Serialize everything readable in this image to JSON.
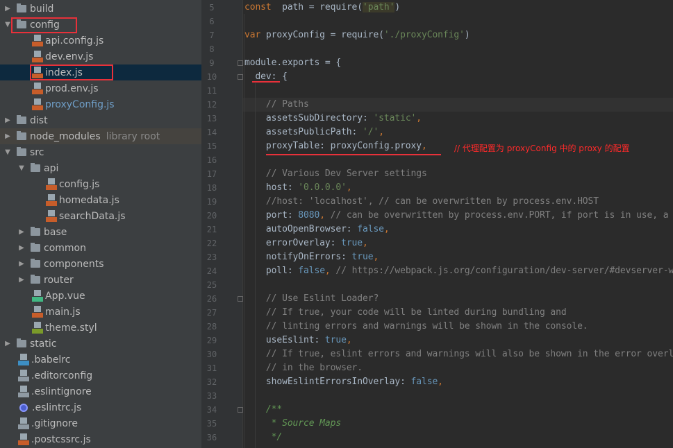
{
  "project_tree": {
    "items": [
      {
        "label": "build",
        "type": "folder",
        "expanded": false,
        "depth": 0
      },
      {
        "label": "config",
        "type": "folder",
        "expanded": true,
        "depth": 0,
        "highlighted": true
      },
      {
        "label": "api.config.js",
        "type": "js",
        "depth": 1
      },
      {
        "label": "dev.env.js",
        "type": "js",
        "depth": 1
      },
      {
        "label": "index.js",
        "type": "js",
        "depth": 1,
        "selected": true,
        "highlighted": true
      },
      {
        "label": "prod.env.js",
        "type": "js",
        "depth": 1
      },
      {
        "label": "proxyConfig.js",
        "type": "js",
        "depth": 1,
        "modified": true
      },
      {
        "label": "dist",
        "type": "folder",
        "expanded": false,
        "depth": 0
      },
      {
        "label": "node_modules",
        "type": "folder",
        "expanded": false,
        "depth": 0,
        "suffix": "library root"
      },
      {
        "label": "src",
        "type": "folder",
        "expanded": true,
        "depth": 0
      },
      {
        "label": "api",
        "type": "folder",
        "expanded": true,
        "depth": 1
      },
      {
        "label": "config.js",
        "type": "js",
        "depth": 2
      },
      {
        "label": "homedata.js",
        "type": "js",
        "depth": 2
      },
      {
        "label": "searchData.js",
        "type": "js",
        "depth": 2
      },
      {
        "label": "base",
        "type": "folder",
        "expanded": false,
        "depth": 1
      },
      {
        "label": "common",
        "type": "folder",
        "expanded": false,
        "depth": 1
      },
      {
        "label": "components",
        "type": "folder",
        "expanded": false,
        "depth": 1
      },
      {
        "label": "router",
        "type": "folder",
        "expanded": false,
        "depth": 1
      },
      {
        "label": "App.vue",
        "type": "vue",
        "depth": 1
      },
      {
        "label": "main.js",
        "type": "js",
        "depth": 1
      },
      {
        "label": "theme.styl",
        "type": "styl",
        "depth": 1
      },
      {
        "label": "static",
        "type": "folder",
        "expanded": false,
        "depth": 0
      },
      {
        "label": ".babelrc",
        "type": "json",
        "depth": 0
      },
      {
        "label": ".editorconfig",
        "type": "text",
        "depth": 0
      },
      {
        "label": ".eslintignore",
        "type": "text",
        "depth": 0
      },
      {
        "label": ".eslintrc.js",
        "type": "eslint",
        "depth": 0
      },
      {
        "label": ".gitignore",
        "type": "text",
        "depth": 0
      },
      {
        "label": ".postcssrc.js",
        "type": "js",
        "depth": 0
      }
    ]
  },
  "editor": {
    "annotation": "// 代理配置为 proxyConfig 中的 proxy 的配置",
    "lines": [
      {
        "n": "5",
        "seg": [
          [
            "kw",
            "const"
          ],
          [
            "",
            "  path = require("
          ],
          [
            "strhl",
            "'path'"
          ],
          [
            "",
            ")"
          ]
        ]
      },
      {
        "n": "6",
        "seg": []
      },
      {
        "n": "7",
        "seg": [
          [
            "kw",
            "var"
          ],
          [
            "",
            " proxyConfig = require("
          ],
          [
            "str",
            "'./proxyConfig'"
          ],
          [
            "",
            ")"
          ]
        ]
      },
      {
        "n": "8",
        "seg": []
      },
      {
        "n": "9",
        "seg": [
          [
            "",
            "module.exports = {"
          ]
        ]
      },
      {
        "n": "10",
        "seg": [
          [
            "",
            "  dev: {"
          ]
        ]
      },
      {
        "n": "11",
        "seg": []
      },
      {
        "n": "12",
        "seg": [
          [
            "",
            "    "
          ],
          [
            "cm",
            "// Paths"
          ]
        ]
      },
      {
        "n": "13",
        "seg": [
          [
            "",
            "    assetsSubDirectory: "
          ],
          [
            "str",
            "'static'"
          ],
          [
            "kw",
            ","
          ]
        ]
      },
      {
        "n": "14",
        "seg": [
          [
            "",
            "    assetsPublicPath: "
          ],
          [
            "str",
            "'/'"
          ],
          [
            "kw",
            ","
          ]
        ]
      },
      {
        "n": "15",
        "seg": [
          [
            "",
            "    proxyTable: proxyConfig.proxy"
          ],
          [
            "kw",
            ","
          ]
        ]
      },
      {
        "n": "16",
        "seg": []
      },
      {
        "n": "17",
        "seg": [
          [
            "",
            "    "
          ],
          [
            "cm",
            "// Various Dev Server settings"
          ]
        ]
      },
      {
        "n": "18",
        "seg": [
          [
            "",
            "    host: "
          ],
          [
            "str",
            "'0.0.0.0'"
          ],
          [
            "kw",
            ","
          ]
        ]
      },
      {
        "n": "19",
        "seg": [
          [
            "",
            "    "
          ],
          [
            "cm",
            "//host: 'localhost', // can be overwritten by process.env.HOST"
          ]
        ]
      },
      {
        "n": "20",
        "seg": [
          [
            "",
            "    port: "
          ],
          [
            "num",
            "8080"
          ],
          [
            "kw",
            ","
          ],
          [
            "cm",
            " // can be overwritten by process.env.PORT, if port is in use, a free one will be determined"
          ]
        ]
      },
      {
        "n": "21",
        "seg": [
          [
            "",
            "    autoOpenBrowser: "
          ],
          [
            "bool",
            "false"
          ],
          [
            "kw",
            ","
          ]
        ]
      },
      {
        "n": "22",
        "seg": [
          [
            "",
            "    errorOverlay: "
          ],
          [
            "bool",
            "true"
          ],
          [
            "kw",
            ","
          ]
        ]
      },
      {
        "n": "23",
        "seg": [
          [
            "",
            "    notifyOnErrors: "
          ],
          [
            "bool",
            "true"
          ],
          [
            "kw",
            ","
          ]
        ]
      },
      {
        "n": "24",
        "seg": [
          [
            "",
            "    poll: "
          ],
          [
            "bool",
            "false"
          ],
          [
            "kw",
            ","
          ],
          [
            "cm",
            " // https://webpack.js.org/configuration/dev-server/#devserver-watchoptions-"
          ]
        ]
      },
      {
        "n": "25",
        "seg": []
      },
      {
        "n": "26",
        "seg": [
          [
            "",
            "    "
          ],
          [
            "cm",
            "// Use Eslint Loader?"
          ]
        ]
      },
      {
        "n": "27",
        "seg": [
          [
            "",
            "    "
          ],
          [
            "cm",
            "// If true, your code will be linted during bundling and"
          ]
        ]
      },
      {
        "n": "28",
        "seg": [
          [
            "",
            "    "
          ],
          [
            "cm",
            "// linting errors and warnings will be shown in the console."
          ]
        ]
      },
      {
        "n": "29",
        "seg": [
          [
            "",
            "    useEslint: "
          ],
          [
            "bool",
            "true"
          ],
          [
            "kw",
            ","
          ]
        ]
      },
      {
        "n": "30",
        "seg": [
          [
            "",
            "    "
          ],
          [
            "cm",
            "// If true, eslint errors and warnings will also be shown in the error overlay"
          ]
        ]
      },
      {
        "n": "31",
        "seg": [
          [
            "",
            "    "
          ],
          [
            "cm",
            "// in the browser."
          ]
        ]
      },
      {
        "n": "32",
        "seg": [
          [
            "",
            "    showEslintErrorsInOverlay: "
          ],
          [
            "bool",
            "false"
          ],
          [
            "kw",
            ","
          ]
        ]
      },
      {
        "n": "33",
        "seg": []
      },
      {
        "n": "34",
        "seg": [
          [
            "",
            "    "
          ],
          [
            "doc",
            "/**"
          ]
        ]
      },
      {
        "n": "35",
        "seg": [
          [
            "",
            "     "
          ],
          [
            "doc",
            "* Source Maps"
          ]
        ]
      },
      {
        "n": "36",
        "seg": [
          [
            "",
            "     "
          ],
          [
            "doc",
            "*/"
          ]
        ]
      }
    ]
  },
  "colors": {
    "highlight_box": "#e8313a",
    "selection": "#0d293e",
    "annotation": "#ff2a2a"
  }
}
